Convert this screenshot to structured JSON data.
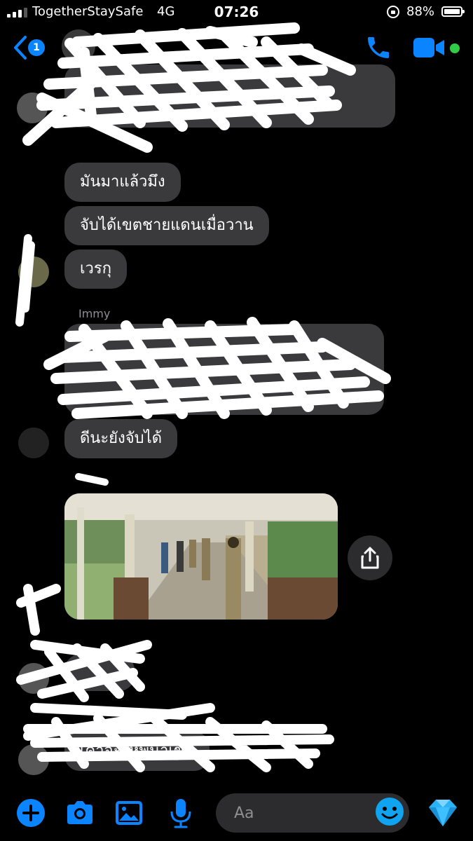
{
  "status_bar": {
    "carrier": "TogetherStaySafe",
    "network": "4G",
    "time": "07:26",
    "battery": "88%"
  },
  "header": {
    "back_badge": "1",
    "icons": [
      "back-chevron-icon",
      "phone-icon",
      "video-camera-icon"
    ],
    "accent_color": "#0a84ff",
    "online_color": "#31cc46"
  },
  "messages": [
    {
      "text": "มันมาแล้วมึง"
    },
    {
      "text": "จับได้เขตชายแดนเมื่อวาน"
    },
    {
      "text": "เวรกุ"
    },
    {
      "sender": "Immy"
    },
    {
      "text": "ดีนะยังจับได้"
    },
    {
      "text": "เค้าจะให้พี่น้ำเขต"
    }
  ],
  "composer": {
    "placeholder": "Aa",
    "icons": [
      "plus-icon",
      "camera-icon",
      "gallery-icon",
      "microphone-icon",
      "emoji-icon",
      "diamond-icon"
    ]
  }
}
